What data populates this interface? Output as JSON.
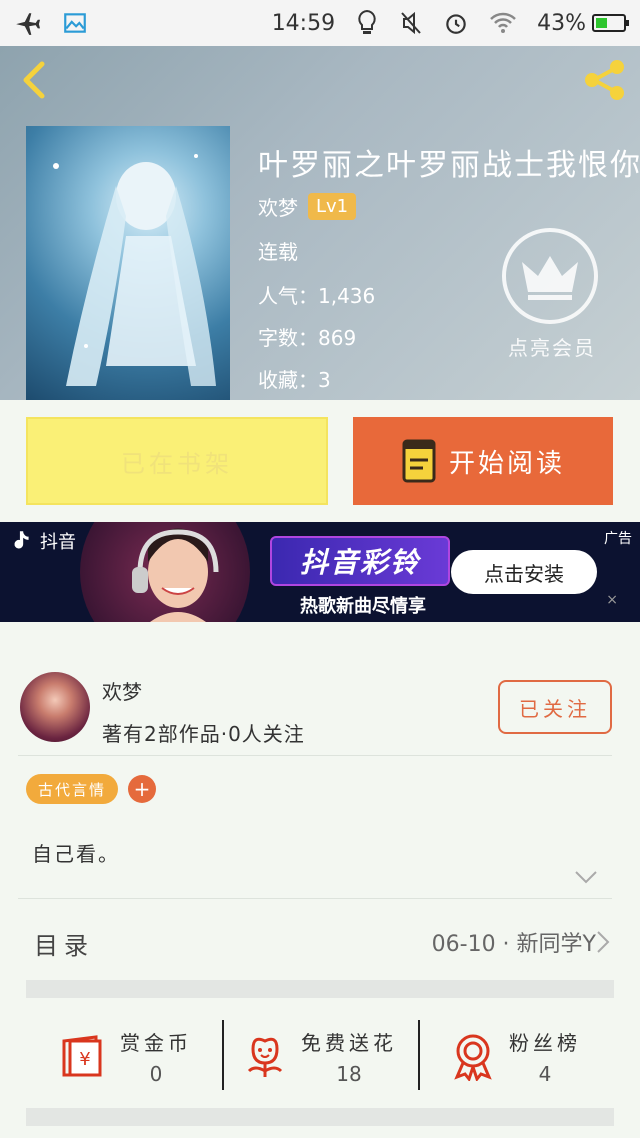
{
  "status_bar": {
    "time": "14:59",
    "battery": "43%",
    "battery_level": 0.43,
    "icons": [
      "airplane-icon",
      "image-icon",
      "bulb-icon",
      "mute-icon",
      "alarm-icon",
      "wifi-icon",
      "battery-icon"
    ]
  },
  "book": {
    "title": "叶罗丽之叶罗丽战士我恨你",
    "author": "欢梦",
    "level": "Lv1",
    "status": "连载",
    "popularity_label": "人气：",
    "popularity": "1,436",
    "words_label": "字数：",
    "words": "869",
    "favorites_label": "收藏：",
    "favorites": "3",
    "vip_label": "点亮会员"
  },
  "actions": {
    "shelf_label": "已在书架",
    "read_label": "开始阅读"
  },
  "ad": {
    "brand": "抖音",
    "title": "抖音彩铃",
    "subtitle": "热歌新曲尽情享",
    "install_label": "点击安装",
    "tag": "广告",
    "close": "×"
  },
  "author_section": {
    "name": "欢梦",
    "works": "著有2部作品·0人关注",
    "follow_label": "已关注",
    "tag": "古代言情",
    "tag_add": "+",
    "description": "自己看。",
    "toc_label": "目录",
    "toc_latest": "06-10 · 新同学Y"
  },
  "stats": [
    {
      "label": "赏金币",
      "value": "0",
      "icon": "red-envelope-icon"
    },
    {
      "label": "免费送花",
      "value": "18",
      "icon": "flower-icon"
    },
    {
      "label": "粉丝榜",
      "value": "4",
      "icon": "medal-icon"
    }
  ],
  "colors": {
    "accent": "#e8693a",
    "shelf_yellow": "#faf076",
    "tag_orange": "#f2aa3c",
    "background": "#f3f7f1"
  }
}
